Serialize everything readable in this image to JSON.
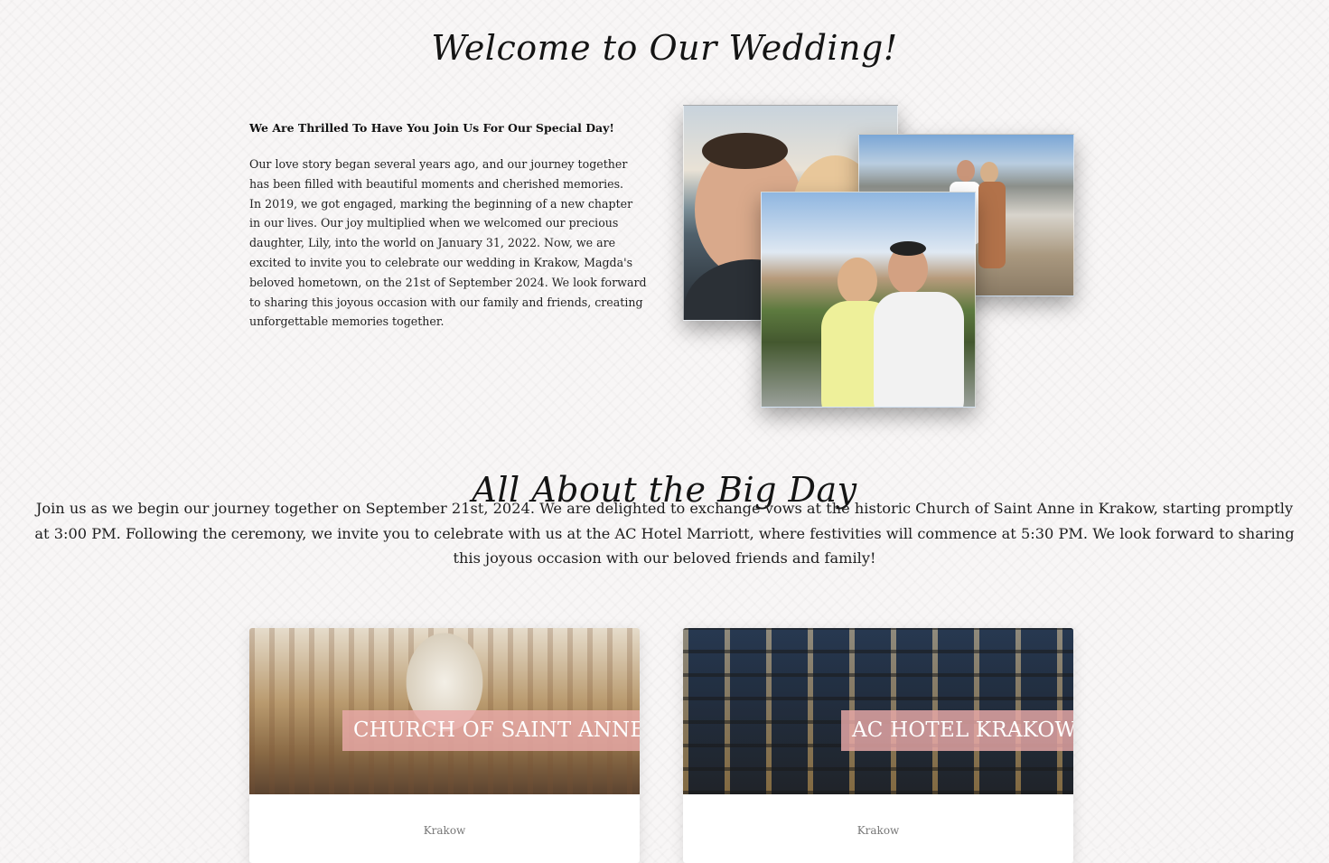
{
  "welcome": {
    "title": "Welcome to Our Wedding!",
    "heading": "We Are Thrilled To Have You Join Us For Our Special Day!",
    "paragraph_1": "Our love story began several years ago, and our journey together has been filled with beautiful moments and cherished memories.",
    "paragraph_2": "In 2019, we got engaged, marking the beginning of a new chapter in our lives. Our joy multiplied when we welcomed our precious daughter, Lily, into the world on January 31, 2022. Now, we are excited to invite you to celebrate our wedding in Krakow, Magda's beloved hometown, on the 21st of September 2024. We look forward to sharing this joyous occasion with our family and friends, creating unforgettable memories together."
  },
  "big_day": {
    "title": "All About the Big Day",
    "text": "Join us as we begin our journey together on September 21st, 2024. We are delighted to exchange vows at the historic Church of Saint Anne in Krakow, starting promptly at 3:00 PM. Following the ceremony, we invite you to celebrate with us at the AC Hotel Marriott, where festivities will commence at 5:30 PM. We look forward to sharing this joyous occasion with our beloved friends and family!"
  },
  "venues": [
    {
      "name": "CHURCH OF SAINT ANNE'S",
      "city": "Krakow"
    },
    {
      "name": "AC HOTEL KRAKOW",
      "city": "Krakow"
    }
  ],
  "colors": {
    "background": "#f8f6f6",
    "label_pink": "#e9aaa8",
    "text": "#1d1d1d"
  }
}
